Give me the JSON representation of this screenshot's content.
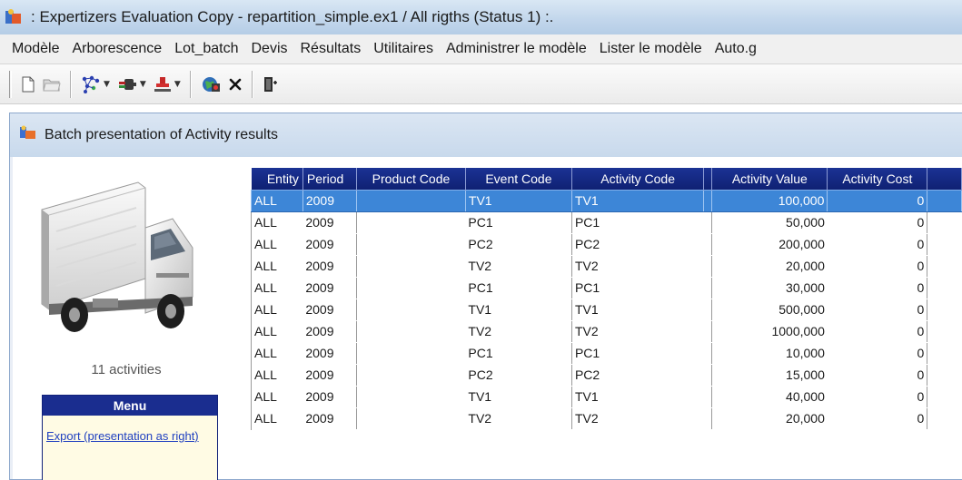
{
  "window": {
    "title": ":   Expertizers Evaluation Copy  -  repartition_simple.ex1  /  All rigths (Status 1)  :."
  },
  "menubar": {
    "items": [
      "Modèle",
      "Arborescence",
      "Lot_batch",
      "Devis",
      "Résultats",
      "Utilitaires",
      "Administrer le modèle",
      "Lister le modèle",
      "Auto.g"
    ]
  },
  "toolbar": {
    "icons": [
      "new-document-icon",
      "open-folder-icon",
      "network-icon",
      "plug-icon",
      "stamp-icon",
      "globe-icon",
      "delete-icon",
      "exit-door-icon"
    ]
  },
  "child_window": {
    "title": "Batch presentation of Activity results"
  },
  "left_panel": {
    "activities_count": "11 activities",
    "menu_title": "Menu",
    "export_link": "Export (presentation as right)"
  },
  "grid": {
    "columns": [
      "Entity",
      "Period",
      "Product Code",
      "Event Code",
      "Activity Code",
      "Activity Value",
      "Activity Cost"
    ],
    "rows": [
      [
        "ALL",
        "2009",
        "",
        "TV1",
        "TV1",
        "100,000",
        "0"
      ],
      [
        "ALL",
        "2009",
        "",
        "PC1",
        "PC1",
        "50,000",
        "0"
      ],
      [
        "ALL",
        "2009",
        "",
        "PC2",
        "PC2",
        "200,000",
        "0"
      ],
      [
        "ALL",
        "2009",
        "",
        "TV2",
        "TV2",
        "20,000",
        "0"
      ],
      [
        "ALL",
        "2009",
        "",
        "PC1",
        "PC1",
        "30,000",
        "0"
      ],
      [
        "ALL",
        "2009",
        "",
        "TV1",
        "TV1",
        "500,000",
        "0"
      ],
      [
        "ALL",
        "2009",
        "",
        "TV2",
        "TV2",
        "1000,000",
        "0"
      ],
      [
        "ALL",
        "2009",
        "",
        "PC1",
        "PC1",
        "10,000",
        "0"
      ],
      [
        "ALL",
        "2009",
        "",
        "PC2",
        "PC2",
        "15,000",
        "0"
      ],
      [
        "ALL",
        "2009",
        "",
        "TV1",
        "TV1",
        "40,000",
        "0"
      ],
      [
        "ALL",
        "2009",
        "",
        "TV2",
        "TV2",
        "20,000",
        "0"
      ]
    ],
    "selected_row": 0
  },
  "colors": {
    "grid_header": "#1b3294",
    "selection": "#3d86d7",
    "menu_box_header": "#1a2d8f",
    "link": "#2040c0"
  }
}
